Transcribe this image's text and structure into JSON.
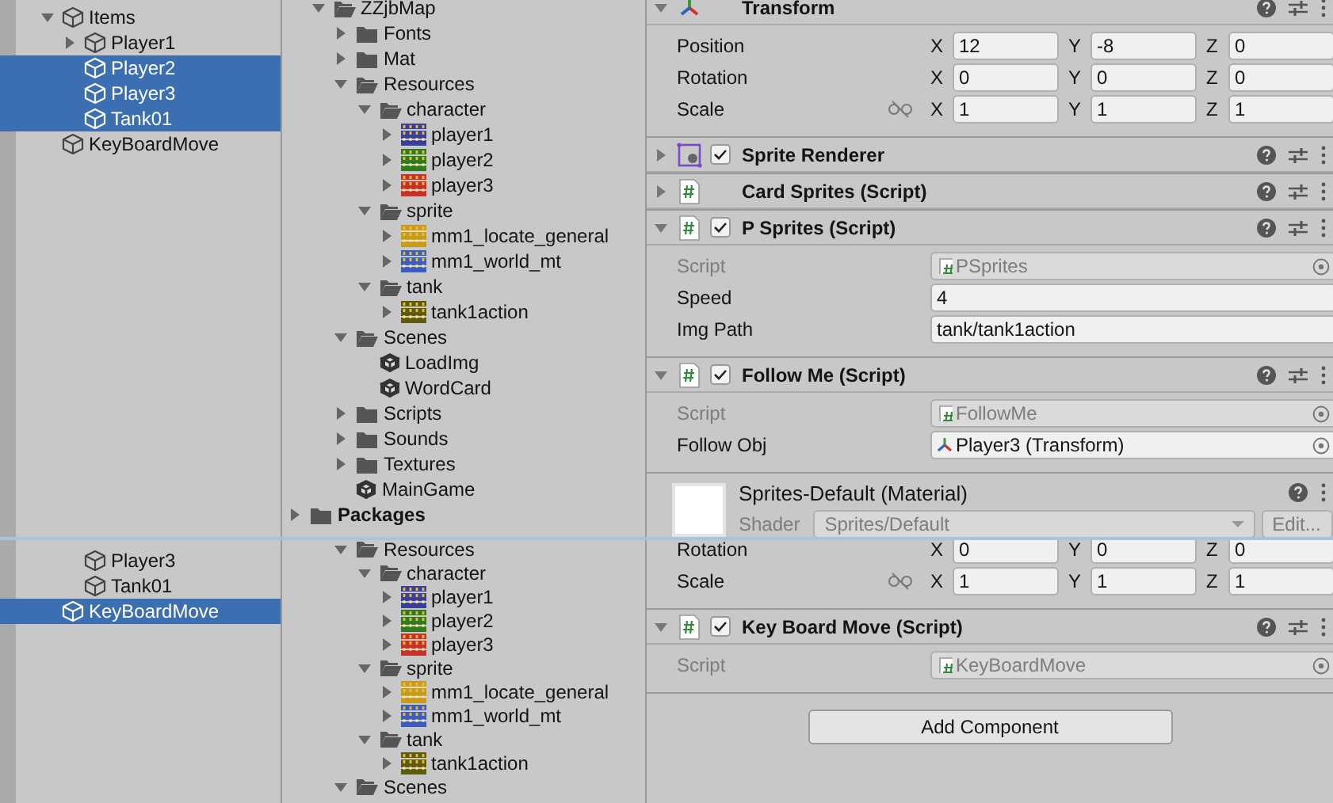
{
  "panes": [
    {
      "hierarchy": [
        {
          "label": "Items",
          "kind": "object",
          "expanded": true,
          "selected": false,
          "children": [
            {
              "label": "Player1",
              "kind": "object",
              "expanded": false,
              "selected": false
            },
            {
              "label": "Player2",
              "kind": "object",
              "selected": true
            },
            {
              "label": "Player3",
              "kind": "object",
              "selected": true
            },
            {
              "label": "Tank01",
              "kind": "object",
              "selected": true
            }
          ]
        },
        {
          "label": "KeyBoardMove",
          "kind": "object",
          "selected": false
        }
      ],
      "project": [
        {
          "children": [
            {
              "label": "ZZjbMap",
              "kind": "folder",
              "expanded": true,
              "children": [
                {
                  "label": "Fonts",
                  "kind": "folder",
                  "expanded": false
                },
                {
                  "label": "Mat",
                  "kind": "folder",
                  "expanded": false
                },
                {
                  "label": "Resources",
                  "kind": "folder",
                  "expanded": true,
                  "children": [
                    {
                      "label": "character",
                      "kind": "folder",
                      "expanded": true,
                      "children": [
                        {
                          "label": "player1",
                          "kind": "sprite",
                          "expanded": false,
                          "color": "#3a3f9a"
                        },
                        {
                          "label": "player2",
                          "kind": "sprite",
                          "expanded": false,
                          "color": "#2f7a22"
                        },
                        {
                          "label": "player3",
                          "kind": "sprite",
                          "expanded": false,
                          "color": "#c8302c"
                        }
                      ]
                    },
                    {
                      "label": "sprite",
                      "kind": "folder",
                      "expanded": true,
                      "children": [
                        {
                          "label": "mm1_locate_general",
                          "kind": "sprite",
                          "expanded": false,
                          "color": "#c89a1e"
                        },
                        {
                          "label": "mm1_world_mt",
                          "kind": "sprite",
                          "expanded": false,
                          "color": "#3c5cc0"
                        }
                      ]
                    },
                    {
                      "label": "tank",
                      "kind": "folder",
                      "expanded": true,
                      "children": [
                        {
                          "label": "tank1action",
                          "kind": "sprite",
                          "expanded": false,
                          "color": "#5e5a10"
                        }
                      ]
                    }
                  ]
                },
                {
                  "label": "Scenes",
                  "kind": "folder",
                  "expanded": true,
                  "children": [
                    {
                      "label": "LoadImg",
                      "kind": "scene"
                    },
                    {
                      "label": "WordCard",
                      "kind": "scene"
                    }
                  ]
                },
                {
                  "label": "Scripts",
                  "kind": "folder",
                  "expanded": false
                },
                {
                  "label": "Sounds",
                  "kind": "folder",
                  "expanded": false
                },
                {
                  "label": "Textures",
                  "kind": "folder",
                  "expanded": false
                },
                {
                  "label": "MainGame",
                  "kind": "scene"
                }
              ]
            }
          ]
        },
        {
          "label": "Packages",
          "kind": "folder",
          "expanded": false,
          "bold": true
        }
      ],
      "inspector": {
        "components": [
          {
            "kind": "transform",
            "title": "Transform",
            "expanded": true,
            "rows": [
              {
                "label": "Position",
                "kind": "vector",
                "axes": [
                  {
                    "axis": "X",
                    "value": "12"
                  },
                  {
                    "axis": "Y",
                    "value": "-8"
                  },
                  {
                    "axis": "Z",
                    "value": "0"
                  }
                ]
              },
              {
                "label": "Rotation",
                "kind": "vector",
                "axes": [
                  {
                    "axis": "X",
                    "value": "0"
                  },
                  {
                    "axis": "Y",
                    "value": "0"
                  },
                  {
                    "axis": "Z",
                    "value": "0"
                  }
                ]
              },
              {
                "label": "Scale",
                "kind": "vector",
                "proportions_locked": false,
                "axes": [
                  {
                    "axis": "X",
                    "value": "1"
                  },
                  {
                    "axis": "Y",
                    "value": "1"
                  },
                  {
                    "axis": "Z",
                    "value": "1"
                  }
                ]
              }
            ]
          },
          {
            "kind": "sprite-renderer",
            "title": "Sprite Renderer",
            "expanded": false,
            "enabled": true
          },
          {
            "kind": "script",
            "title": "Card Sprites (Script)",
            "expanded": false
          },
          {
            "kind": "script",
            "title": "P Sprites (Script)",
            "expanded": true,
            "enabled": true,
            "rows": [
              {
                "label": "Script",
                "kind": "script",
                "value": "PSprites",
                "disabled": true
              },
              {
                "label": "Speed",
                "kind": "text",
                "value": "4",
                "disabled": false
              },
              {
                "label": "Img Path",
                "kind": "text",
                "value": "tank/tank1action",
                "disabled": false
              }
            ]
          },
          {
            "kind": "script",
            "title": "Follow Me (Script)",
            "expanded": true,
            "enabled": true,
            "rows": [
              {
                "label": "Script",
                "kind": "script",
                "value": "FollowMe",
                "disabled": true
              },
              {
                "label": "Follow Obj",
                "kind": "object",
                "value": "Player3 (Transform)",
                "disabled": false
              }
            ]
          },
          {
            "kind": "material",
            "title": "Sprites-Default (Material)",
            "shader_label": "Shader",
            "shader": "Sprites/Default",
            "edit_button": "Edit..."
          }
        ]
      }
    },
    {
      "hierarchy": [
        {
          "children": [
            {
              "label": "Player3",
              "kind": "object",
              "selected": false
            },
            {
              "label": "Tank01",
              "kind": "object",
              "selected": false
            }
          ]
        },
        {
          "label": "KeyBoardMove",
          "kind": "object",
          "selected": true
        }
      ],
      "project": [
        {
          "children": [
            {
              "children": [
                {
                  "label": "Resources",
                  "kind": "folder",
                  "expanded": true,
                  "children": [
                    {
                      "label": "character",
                      "kind": "folder",
                      "expanded": true,
                      "children": [
                        {
                          "label": "player1",
                          "kind": "sprite",
                          "expanded": false,
                          "color": "#3a3f9a"
                        },
                        {
                          "label": "player2",
                          "kind": "sprite",
                          "expanded": false,
                          "color": "#2f7a22"
                        },
                        {
                          "label": "player3",
                          "kind": "sprite",
                          "expanded": false,
                          "color": "#c8302c"
                        }
                      ]
                    },
                    {
                      "label": "sprite",
                      "kind": "folder",
                      "expanded": true,
                      "children": [
                        {
                          "label": "mm1_locate_general",
                          "kind": "sprite",
                          "expanded": false,
                          "color": "#c89a1e"
                        },
                        {
                          "label": "mm1_world_mt",
                          "kind": "sprite",
                          "expanded": false,
                          "color": "#3c5cc0"
                        }
                      ]
                    },
                    {
                      "label": "tank",
                      "kind": "folder",
                      "expanded": true,
                      "children": [
                        {
                          "label": "tank1action",
                          "kind": "sprite",
                          "expanded": false,
                          "color": "#5e5a10"
                        }
                      ]
                    }
                  ]
                },
                {
                  "label": "Scenes",
                  "kind": "folder",
                  "expanded": true
                }
              ]
            }
          ]
        }
      ],
      "inspector": {
        "components": [
          {
            "kind": "transform",
            "rows": [
              {
                "label": "Rotation",
                "kind": "vector",
                "axes": [
                  {
                    "axis": "X",
                    "value": "0"
                  },
                  {
                    "axis": "Y",
                    "value": "0"
                  },
                  {
                    "axis": "Z",
                    "value": "0"
                  }
                ]
              },
              {
                "label": "Scale",
                "kind": "vector",
                "proportions_locked": false,
                "axes": [
                  {
                    "axis": "X",
                    "value": "1"
                  },
                  {
                    "axis": "Y",
                    "value": "1"
                  },
                  {
                    "axis": "Z",
                    "value": "1"
                  }
                ]
              }
            ]
          },
          {
            "kind": "script",
            "title": "Key Board Move (Script)",
            "expanded": true,
            "enabled": true,
            "rows": [
              {
                "label": "Script",
                "kind": "script",
                "value": "KeyBoardMove",
                "disabled": true
              }
            ]
          }
        ],
        "buttons": [
          "Add Component"
        ]
      }
    }
  ]
}
